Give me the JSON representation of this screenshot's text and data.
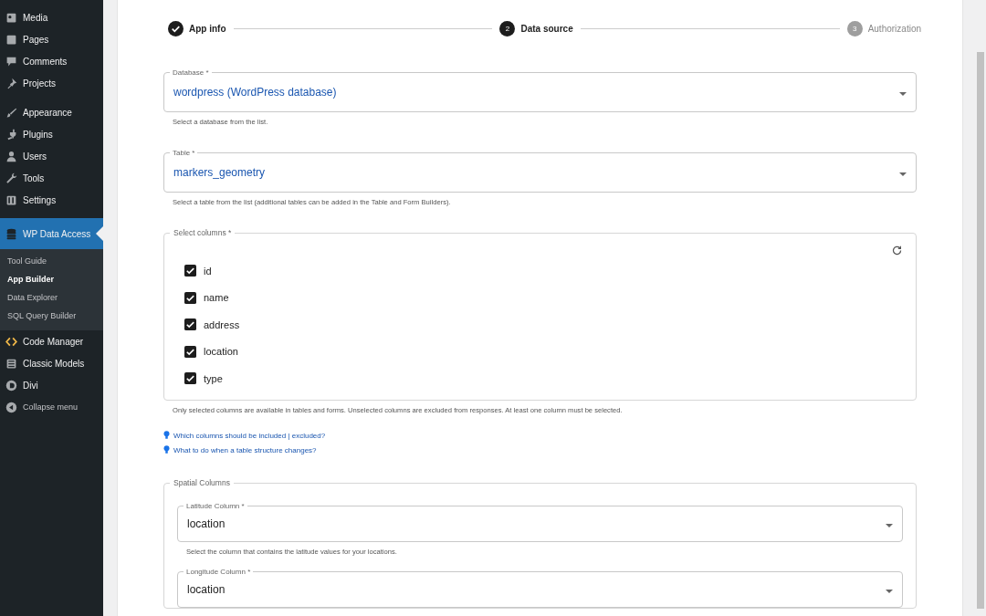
{
  "sidebar": {
    "groups": [
      {
        "items": [
          {
            "label": "Media",
            "selected": false
          },
          {
            "label": "Pages",
            "selected": false
          },
          {
            "label": "Comments",
            "selected": false
          },
          {
            "label": "Projects",
            "selected": false
          }
        ]
      },
      {
        "items": [
          {
            "label": "Appearance",
            "selected": false
          },
          {
            "label": "Plugins",
            "selected": false
          },
          {
            "label": "Users",
            "selected": false
          },
          {
            "label": "Tools",
            "selected": false
          },
          {
            "label": "Settings",
            "selected": false
          }
        ]
      },
      {
        "items": [
          {
            "label": "WP Data Access",
            "selected": true,
            "children": [
              {
                "label": "Tool Guide",
                "selected": false
              },
              {
                "label": "App Builder",
                "selected": true
              },
              {
                "label": "Data Explorer",
                "selected": false
              },
              {
                "label": "SQL Query Builder",
                "selected": false
              }
            ]
          },
          {
            "label": "Code Manager",
            "selected": false
          },
          {
            "label": "Classic Models",
            "selected": false
          },
          {
            "label": "Divi",
            "selected": false
          },
          {
            "label": "Collapse menu",
            "selected": false,
            "kind": "collapse"
          }
        ]
      }
    ]
  },
  "stepper": [
    {
      "label": "App info",
      "kind": "completed"
    },
    {
      "number": "2",
      "label": "Data source",
      "kind": "active"
    },
    {
      "number": "3",
      "label": "Authorization",
      "kind": "pending"
    }
  ],
  "database": {
    "label": "Database *",
    "value": "wordpress (WordPress database)",
    "helper": "Select a database from the list."
  },
  "table": {
    "label": "Table *",
    "value": "markers_geometry",
    "helper": "Select a table from the list (additional tables can be added in the Table and Form Builders)."
  },
  "columns": {
    "legend": "Select columns *",
    "items": [
      {
        "label": "id",
        "checked": true
      },
      {
        "label": "name",
        "checked": true
      },
      {
        "label": "address",
        "checked": true
      },
      {
        "label": "location",
        "checked": true
      },
      {
        "label": "type",
        "checked": true
      }
    ],
    "helper": "Only selected columns are available in tables and forms. Unselected columns are excluded from responses. At least one column must be selected."
  },
  "links": [
    "Which columns should be included | excluded?",
    "What to do when a table structure changes?"
  ],
  "spatial": {
    "legend": "Spatial Columns",
    "fields": [
      {
        "label": "Latitude Column *",
        "value": "location",
        "helper": "Select the column that contains the latitude values for your locations."
      },
      {
        "label": "Longitude Column *",
        "value": "location"
      }
    ]
  }
}
